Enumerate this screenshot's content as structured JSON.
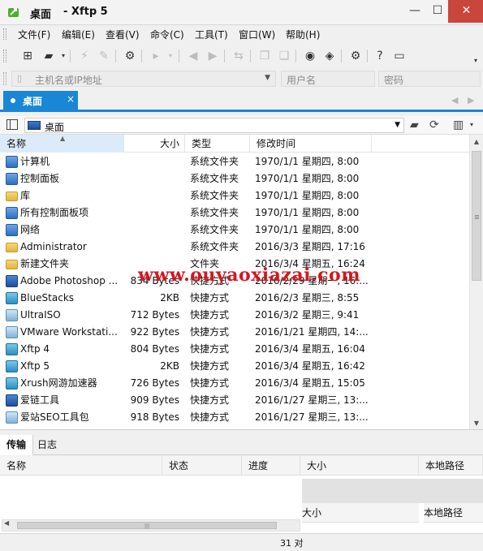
{
  "window": {
    "title": "桌面",
    "app": "- Xftp 5",
    "minimize": "—",
    "maximize": "☐",
    "close": "✕"
  },
  "menu": [
    "文件(F)",
    "编辑(E)",
    "查看(V)",
    "命令(C)",
    "工具(T)",
    "窗口(W)",
    "帮助(H)"
  ],
  "address": {
    "host_placeholder": "主机名或IP地址",
    "user_placeholder": "用户名",
    "password_placeholder": "密码"
  },
  "tabs": [
    {
      "label": "桌面",
      "close": "×"
    }
  ],
  "path": {
    "current": "桌面"
  },
  "columns": {
    "name": "名称",
    "size": "大小",
    "type": "类型",
    "modified": "修改时间"
  },
  "files": [
    {
      "name": "计算机",
      "size": "",
      "type": "系统文件夹",
      "modified": "1970/1/1 星期四, 8:00",
      "icon": "computer-icon"
    },
    {
      "name": "控制面板",
      "size": "",
      "type": "系统文件夹",
      "modified": "1970/1/1 星期四, 8:00",
      "icon": "control-panel-icon"
    },
    {
      "name": "库",
      "size": "",
      "type": "系统文件夹",
      "modified": "1970/1/1 星期四, 8:00",
      "icon": "library-icon"
    },
    {
      "name": "所有控制面板项",
      "size": "",
      "type": "系统文件夹",
      "modified": "1970/1/1 星期四, 8:00",
      "icon": "control-panel-icon"
    },
    {
      "name": "网络",
      "size": "",
      "type": "系统文件夹",
      "modified": "1970/1/1 星期四, 8:00",
      "icon": "network-icon"
    },
    {
      "name": "Administrator",
      "size": "",
      "type": "系统文件夹",
      "modified": "2016/3/3 星期四, 17:16",
      "icon": "user-folder-icon"
    },
    {
      "name": "新建文件夹",
      "size": "",
      "type": "文件夹",
      "modified": "2016/3/4 星期五, 16:24",
      "icon": "folder-icon"
    },
    {
      "name": "Adobe Photoshop ...",
      "size": "834 Bytes",
      "type": "快捷方式",
      "modified": "2016/2/29 星期一, 16:...",
      "icon": "photoshop-icon"
    },
    {
      "name": "BlueStacks",
      "size": "2KB",
      "type": "快捷方式",
      "modified": "2016/2/3 星期三, 8:55",
      "icon": "bluestacks-icon"
    },
    {
      "name": "UltraISO",
      "size": "712 Bytes",
      "type": "快捷方式",
      "modified": "2016/3/2 星期三, 9:41",
      "icon": "ultraiso-icon"
    },
    {
      "name": "VMware Workstati...",
      "size": "922 Bytes",
      "type": "快捷方式",
      "modified": "2016/1/21 星期四, 14:...",
      "icon": "vmware-icon"
    },
    {
      "name": "Xftp 4",
      "size": "804 Bytes",
      "type": "快捷方式",
      "modified": "2016/3/4 星期五, 16:04",
      "icon": "xftp-icon"
    },
    {
      "name": "Xftp 5",
      "size": "2KB",
      "type": "快捷方式",
      "modified": "2016/3/4 星期五, 16:42",
      "icon": "xftp-icon"
    },
    {
      "name": "Xrush网游加速器",
      "size": "726 Bytes",
      "type": "快捷方式",
      "modified": "2016/3/4 星期五, 15:05",
      "icon": "xrush-icon"
    },
    {
      "name": "爱链工具",
      "size": "909 Bytes",
      "type": "快捷方式",
      "modified": "2016/1/27 星期三, 13:...",
      "icon": "ailian-icon"
    },
    {
      "name": "爱站SEO工具包",
      "size": "918 Bytes",
      "type": "快捷方式",
      "modified": "2016/1/27 星期三, 13:...",
      "icon": "aizhan-icon"
    }
  ],
  "watermark": "www.ouyaoxiazai.com",
  "transfer": {
    "tabs": [
      "传输",
      "日志"
    ],
    "columns": {
      "name": "名称",
      "status": "状态",
      "progress": "进度",
      "size": "大小",
      "local_path": "本地路径"
    },
    "columns2": {
      "size": "大小",
      "local_path": "本地路径"
    }
  },
  "status": {
    "objects": "31 对"
  }
}
